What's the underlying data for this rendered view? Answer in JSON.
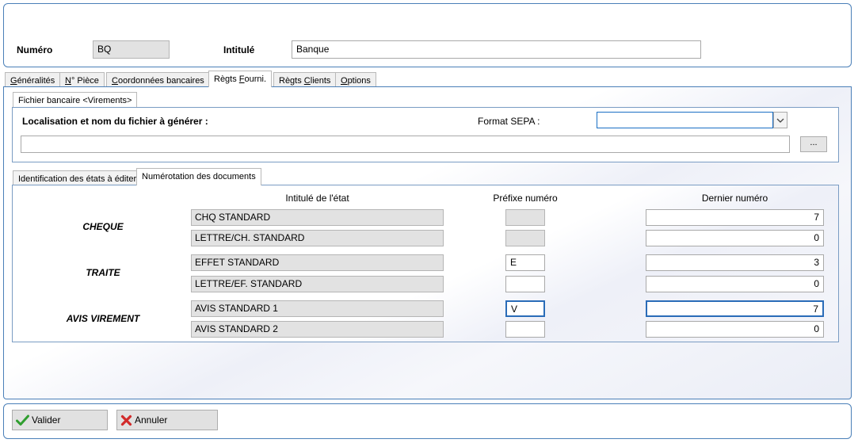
{
  "header": {
    "numero_label": "Numéro",
    "numero_value": "BQ",
    "intitule_label": "Intitulé",
    "intitule_value": "Banque"
  },
  "tabs": [
    {
      "pre": "",
      "ul": "G",
      "post": "énéralités"
    },
    {
      "pre": "",
      "ul": "N",
      "post": "° Pièce"
    },
    {
      "pre": "",
      "ul": "C",
      "post": "oordonnées bancaires"
    },
    {
      "pre": "Règts ",
      "ul": "F",
      "post": "ourni."
    },
    {
      "pre": "Règts ",
      "ul": "C",
      "post": "lients"
    },
    {
      "pre": "",
      "ul": "O",
      "post": "ptions"
    }
  ],
  "active_tab": "Règts Fourni.",
  "subtab_file": "Fichier bancaire <Virements>",
  "file": {
    "location_label": "Localisation et nom du fichier à générer :",
    "sepa_label": "Format SEPA :",
    "sepa_value": "",
    "path_value": "",
    "browse_label": "..."
  },
  "subtabs_docs": [
    "Identification des états à éditer",
    "Numérotation des documents"
  ],
  "table": {
    "col_state": "Intitulé de l'état",
    "col_prefix": "Préfixe numéro",
    "col_last": "Dernier numéro",
    "groups": [
      {
        "label": "CHEQUE",
        "rows": [
          {
            "state": "CHQ STANDARD",
            "prefix": "",
            "last": "7"
          },
          {
            "state": "LETTRE/CH. STANDARD",
            "prefix": "",
            "last": "0"
          }
        ]
      },
      {
        "label": "TRAITE",
        "rows": [
          {
            "state": "EFFET STANDARD",
            "prefix": "E",
            "last": "3"
          },
          {
            "state": "LETTRE/EF. STANDARD",
            "prefix": "",
            "last": "0"
          }
        ]
      },
      {
        "label": "AVIS VIREMENT",
        "rows": [
          {
            "state": "AVIS STANDARD 1",
            "prefix": "V",
            "last": "7"
          },
          {
            "state": "AVIS STANDARD 2",
            "prefix": "",
            "last": "0"
          }
        ]
      }
    ]
  },
  "buttons": {
    "valider": "Valider",
    "annuler": "Annuler"
  },
  "colors": {
    "panel_border": "#4a7fb8",
    "focus_border": "#2a6cb8",
    "ok_green": "#2f9e2f",
    "cancel_red": "#d22b2b"
  },
  "icons": {
    "valider": "check-icon",
    "annuler": "cross-icon"
  }
}
